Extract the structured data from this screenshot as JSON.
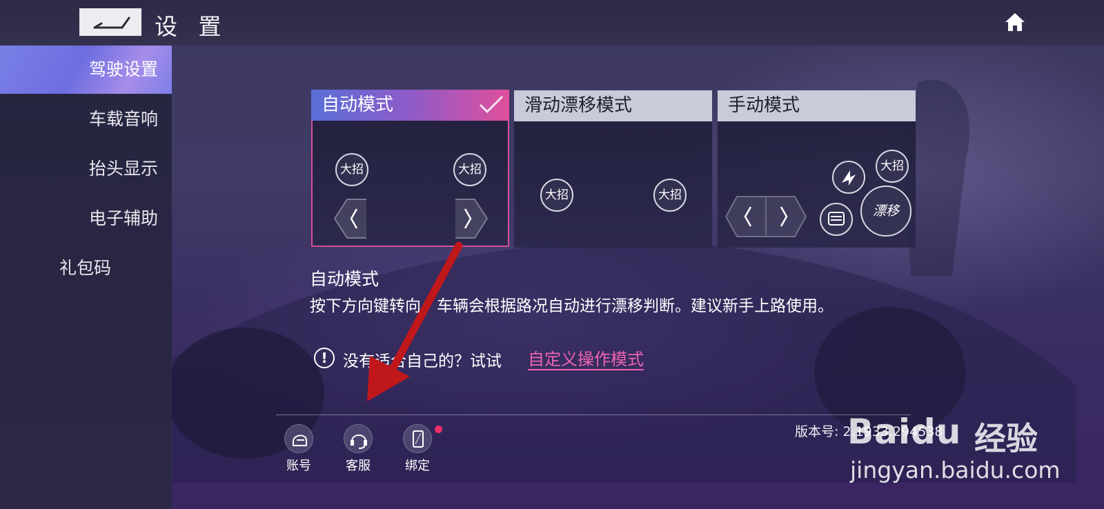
{
  "header": {
    "title": "设 置",
    "back_icon": "back-arrow-icon",
    "home_icon": "home-icon"
  },
  "sidebar": {
    "items": [
      {
        "label": "驾驶设置",
        "active": true
      },
      {
        "label": "车载音响",
        "active": false
      },
      {
        "label": "抬头显示",
        "active": false
      },
      {
        "label": "电子辅助",
        "active": false
      },
      {
        "label": "礼包码",
        "active": false
      }
    ]
  },
  "modes": [
    {
      "label": "自动模式",
      "selected": true,
      "buttons": [
        "大招",
        "大招"
      ]
    },
    {
      "label": "滑动漂移模式",
      "selected": false,
      "buttons": [
        "大招",
        "大招"
      ]
    },
    {
      "label": "手动模式",
      "selected": false,
      "buttons": [
        "大招",
        "漂移"
      ]
    }
  ],
  "description": {
    "title": "自动模式",
    "text": "按下方向键转向，车辆会根据路况自动进行漂移判断。建议新手上路使用。"
  },
  "hint": {
    "icon": "!",
    "text": "没有适合自己的？试试",
    "link": "自定义操作模式"
  },
  "footer": {
    "buttons": [
      {
        "label": "账号",
        "icon": "helmet-icon"
      },
      {
        "label": "客服",
        "icon": "headset-icon"
      },
      {
        "label": "绑定",
        "icon": "phone-icon",
        "badge": true
      }
    ],
    "version": "版本号: 2.1933.294538"
  },
  "watermark": {
    "brand": "Baidu",
    "brand_cn": "经验",
    "url": "jingyan.baidu.com"
  },
  "colors": {
    "accent_pink": "#ee64b2",
    "selected_gradient_start": "#5a6fd8",
    "selected_gradient_end": "#e04f9c",
    "annotation_arrow": "#c0171b",
    "badge": "#f0306a"
  }
}
